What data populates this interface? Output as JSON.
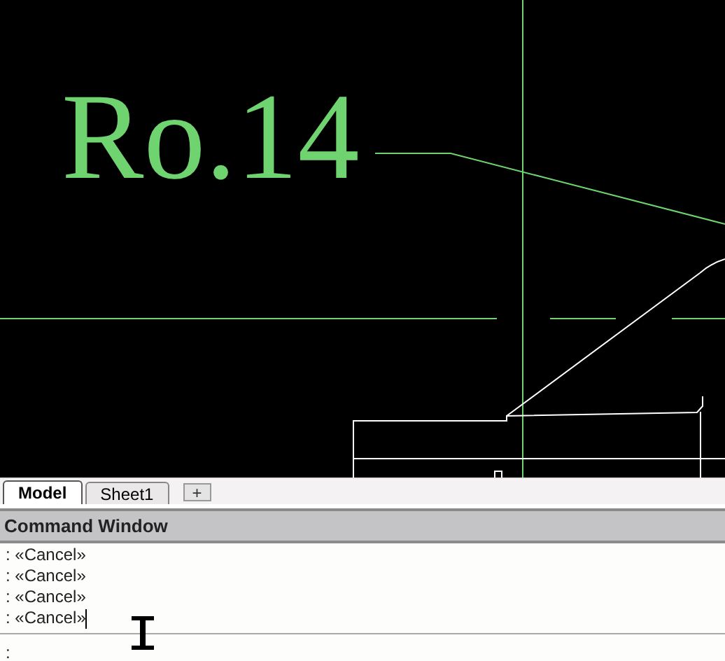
{
  "drawing": {
    "label": "Ro.14"
  },
  "tabs": [
    {
      "label": "Model",
      "selected": true
    },
    {
      "label": "Sheet1",
      "selected": false
    }
  ],
  "add_tab": "+",
  "command_window": {
    "title": "Command Window",
    "history": [
      ": «Cancel»",
      ": «Cancel»",
      ": «Cancel»",
      ": «Cancel»"
    ],
    "prompt": ":"
  }
}
